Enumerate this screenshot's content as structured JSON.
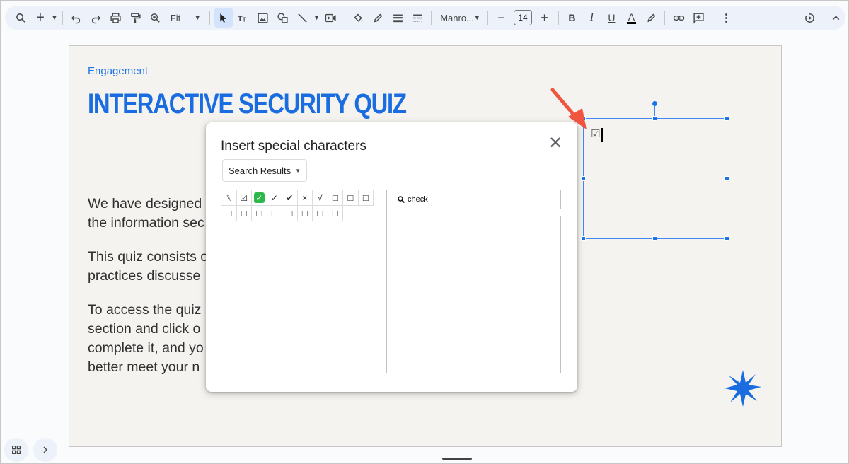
{
  "toolbar": {
    "zoom_value": "Fit",
    "font_name": "Manro...",
    "font_size": "14",
    "bold_glyph": "B",
    "italic_glyph": "I",
    "underline_glyph": "U",
    "text_color_glyph": "A",
    "minus_glyph": "−",
    "plus_glyph": "+"
  },
  "slide": {
    "eyebrow": "Engagement",
    "title": "INTERACTIVE SECURITY QUIZ",
    "paragraphs": [
      "We have designed",
      "the information sec",
      "This quiz consists o",
      "practices discusse",
      "To access the quiz",
      "section and click o",
      "complete it, and yo",
      "better meet your n"
    ],
    "inserted_char": "☑"
  },
  "dialog": {
    "title": "Insert special characters",
    "close_glyph": "✕",
    "category": "Search Results",
    "search_value": "check",
    "characters": [
      "⑊",
      "☑",
      "✅",
      "✓",
      "✔",
      "×",
      "√",
      "□",
      "□",
      "□",
      "□",
      "□",
      "□",
      "□",
      "□",
      "□",
      "□",
      "□"
    ]
  },
  "colors": {
    "accent": "#1a73e8",
    "title_blue": "#1a6de0",
    "slide_bg": "#f5f3ef",
    "arrow": "#f05540"
  }
}
